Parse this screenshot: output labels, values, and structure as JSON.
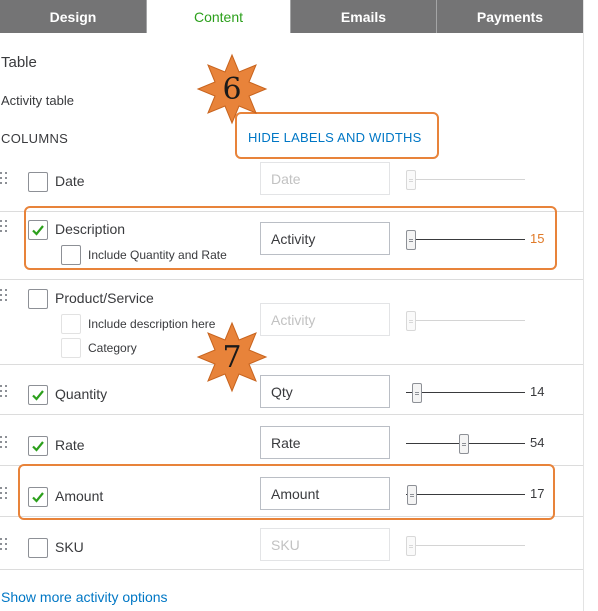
{
  "tabs": [
    {
      "label": "Design"
    },
    {
      "label": "Content"
    },
    {
      "label": "Emails"
    },
    {
      "label": "Payments"
    }
  ],
  "section": {
    "title": "Table",
    "subtitle": "Activity table",
    "columns_label": "COLUMNS",
    "hide_labels_link": "HIDE LABELS AND WIDTHS"
  },
  "callouts": [
    "6",
    "7"
  ],
  "rows": [
    {
      "name": "Date",
      "checked": false,
      "field_value": "Date",
      "enabled": false,
      "slider": null
    },
    {
      "name": "Description",
      "checked": true,
      "field_value": "Activity",
      "enabled": true,
      "slider": "15",
      "sub_options": [
        {
          "label": "Include Quantity and Rate",
          "checked": false
        }
      ]
    },
    {
      "name": "Product/Service",
      "checked": false,
      "field_value": "Activity",
      "enabled": false,
      "slider": null,
      "sub_options": [
        {
          "label": "Include description here",
          "checked": false
        },
        {
          "label": "Category",
          "checked": false
        }
      ]
    },
    {
      "name": "Quantity",
      "checked": true,
      "field_value": "Qty",
      "enabled": true,
      "slider": "14"
    },
    {
      "name": "Rate",
      "checked": true,
      "field_value": "Rate",
      "enabled": true,
      "slider": "54"
    },
    {
      "name": "Amount",
      "checked": true,
      "field_value": "Amount",
      "enabled": true,
      "slider": "17"
    },
    {
      "name": "SKU",
      "checked": false,
      "field_value": "SKU",
      "enabled": false,
      "slider": null
    }
  ],
  "more_link": "Show more activity options",
  "colors": {
    "tab_bg": "#747475",
    "active_tab_text": "#2ca01c",
    "link": "#0077c5",
    "check": "#2ca01c",
    "highlight": "#e8833a",
    "starburst": "#e8833a",
    "accent_value": "#e07a28"
  }
}
